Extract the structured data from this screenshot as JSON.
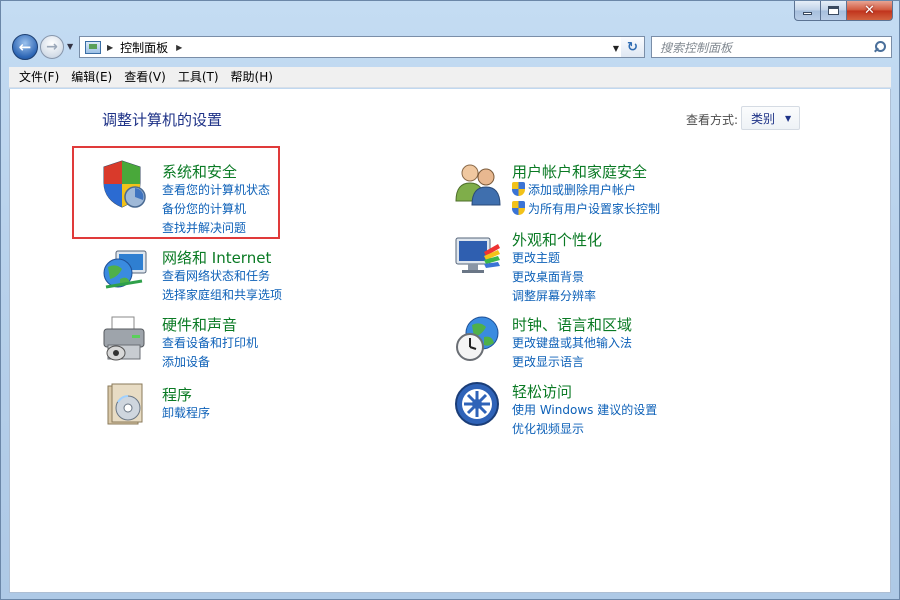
{
  "window": {
    "caption_buttons": {
      "minimize": "minimize",
      "maximize": "maximize",
      "close": "✕"
    }
  },
  "nav": {
    "back_icon": "back-arrow-icon",
    "forward_icon": "forward-arrow-icon",
    "address_path": "控制面板",
    "search_placeholder": "搜索控制面板"
  },
  "menu": [
    "文件(F)",
    "编辑(E)",
    "查看(V)",
    "工具(T)",
    "帮助(H)"
  ],
  "main": {
    "title": "调整计算机的设置",
    "view_by_label": "查看方式:",
    "view_by_value": "类别"
  },
  "categories": {
    "system_security": {
      "title": "系统和安全",
      "links": [
        "查看您的计算机状态",
        "备份您的计算机",
        "查找并解决问题"
      ]
    },
    "network": {
      "title": "网络和 Internet",
      "links": [
        "查看网络状态和任务",
        "选择家庭组和共享选项"
      ]
    },
    "hardware": {
      "title": "硬件和声音",
      "links": [
        "查看设备和打印机",
        "添加设备"
      ]
    },
    "programs": {
      "title": "程序",
      "links": [
        "卸载程序"
      ]
    },
    "user_accounts": {
      "title": "用户帐户和家庭安全",
      "links": [
        "添加或删除用户帐户",
        "为所有用户设置家长控制"
      ]
    },
    "appearance": {
      "title": "外观和个性化",
      "links": [
        "更改主题",
        "更改桌面背景",
        "调整屏幕分辨率"
      ]
    },
    "clock_region": {
      "title": "时钟、语言和区域",
      "links": [
        "更改键盘或其他输入法",
        "更改显示语言"
      ]
    },
    "ease_access": {
      "title": "轻松访问",
      "links": [
        "使用 Windows 建议的设置",
        "优化视频显示"
      ]
    }
  },
  "colors": {
    "category_title": "#0a7a24",
    "link": "#0e61b8",
    "heading": "#1e3287",
    "highlight": "#e03a3a"
  }
}
